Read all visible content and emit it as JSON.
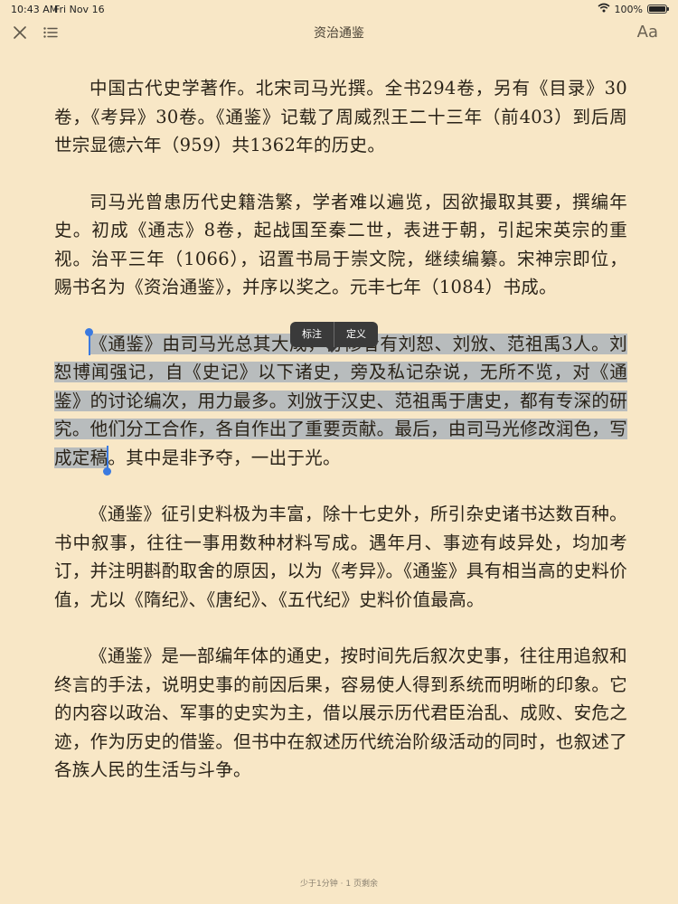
{
  "status_bar": {
    "time": "10:43 AM",
    "date": "Fri Nov 16",
    "battery_text": "100%",
    "battery_level": 1.0,
    "wifi_icon": "wifi-icon"
  },
  "toolbar": {
    "title": "资治通鉴",
    "font_button": "Aa",
    "close_icon": "close-icon",
    "toc_icon": "list-icon"
  },
  "paragraphs": [
    "中国古代史学著作。北宋司马光撰。全书294卷，另有《目录》30卷，《考异》30卷。《通鉴》记载了周威烈王二十三年（前403）到后周世宗显德六年（959）共1362年的历史。",
    "司马光曾患历代史籍浩繁，学者难以遍览，因欲撮取其要，撰编年史。初成《通志》8卷，起战国至秦二世，表进于朝，引起宋英宗的重视。治平三年（1066），诏置书局于崇文院，继续编纂。宋神宗即位，赐书名为《资治通鉴》，并序以奖之。元丰七年（1084）书成。",
    {
      "selected": "《通鉴》由司马光总其大成，协修者有刘恕、刘攽、范祖禹3人。刘恕博闻强记，自《史记》以下诸史，旁及私记杂说，无所不览，对《通鉴》的讨论编次，用力最多。刘攽于汉史、范祖禹于唐史，都有专深的研究。他们分工合作，各自作出了重要贡献。最后，由司马光修改润色，写成定稿",
      "rest": "。其中是非予夺，一出于光。"
    },
    "《通鉴》征引史料极为丰富，除十七史外，所引杂史诸书达数百种。书中叙事，往往一事用数种材料写成。遇年月、事迹有歧异处，均加考订，并注明斟酌取舍的原因，以为《考异》。《通鉴》具有相当高的史料价值，尤以《隋纪》、《唐纪》、《五代纪》史料价值最高。",
    "《通鉴》是一部编年体的通史，按时间先后叙次史事，往往用追叙和终言的手法，说明史事的前因后果，容易使人得到系统而明晰的印象。它的内容以政治、军事的史实为主，借以展示历代君臣治乱、成败、安危之迹，作为历史的借鉴。但书中在叙述历代统治阶级活动的同时，也叙述了各族人民的生活与斗争。"
  ],
  "popup": {
    "annotate": "标注",
    "define": "定义"
  },
  "footer": {
    "reading_status": "少于1分钟 · 1 页剩余"
  },
  "colors": {
    "page_background": "#f8e7c6",
    "selection": "#b8bcbd",
    "selection_handle": "#3b7ae0",
    "popup_background": "#3a3a3a"
  }
}
